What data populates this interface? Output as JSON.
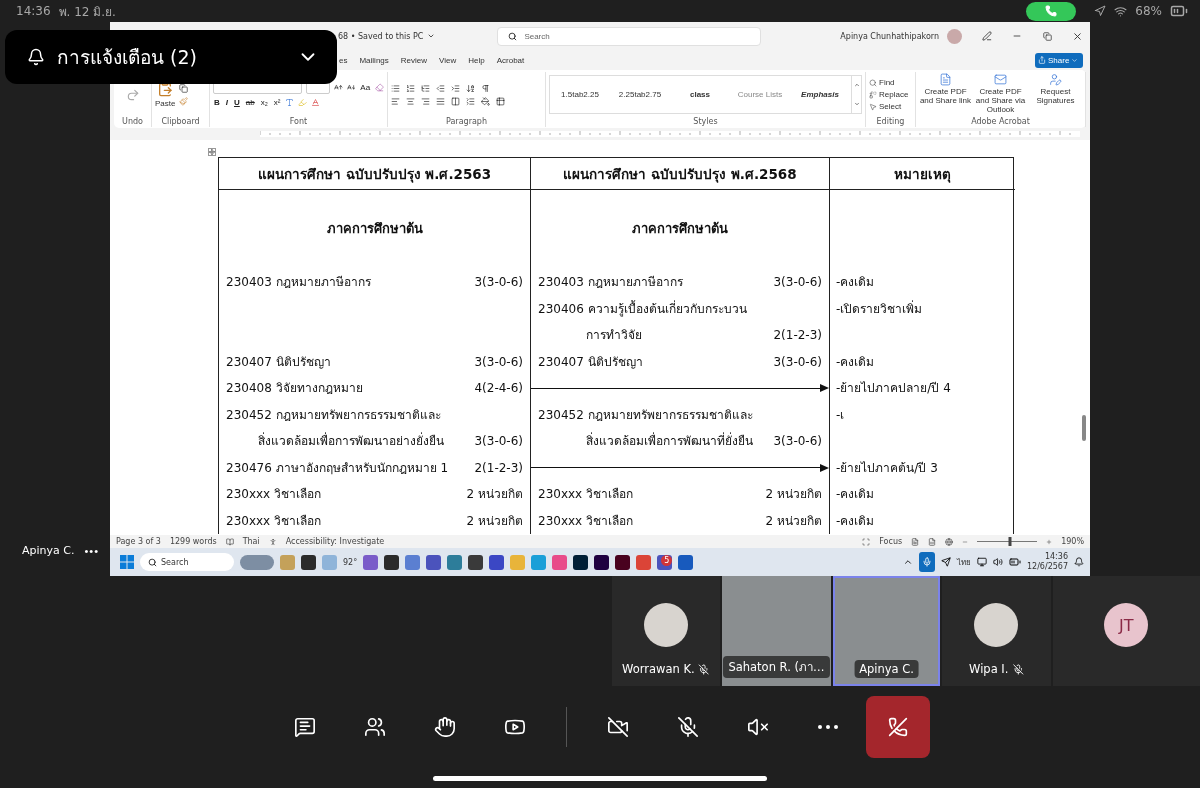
{
  "status_bar": {
    "time": "14:36",
    "date": "พ. 12 มิ.ย.",
    "battery": "68%"
  },
  "notification": {
    "title": "การแจ้งเตือน (2)"
  },
  "word": {
    "title": "68 • Saved to this PC",
    "search": {
      "placeholder": "Search"
    },
    "user": "Apinya Chunhathipakorn",
    "share": "Share",
    "tabs": [
      "es",
      "Mailings",
      "Review",
      "View",
      "Help",
      "Acrobat"
    ],
    "ribbon": {
      "undo": "Undo",
      "paste": "Paste",
      "clipboard": "Clipboard",
      "font": {
        "label": "Font",
        "change_case": "Aa",
        "bold": "B",
        "italic": "I",
        "underline": "U",
        "strike": "ab",
        "subscript": "x₂",
        "superscript": "x²"
      },
      "paragraph": "Paragraph",
      "styles": {
        "label": "Styles",
        "items": [
          {
            "label": "1.5tab2.25",
            "kind": "plain"
          },
          {
            "label": "2.25tab2.75",
            "kind": "plain"
          },
          {
            "label": "class",
            "kind": "strong"
          },
          {
            "label": "Course Lists",
            "kind": "light"
          },
          {
            "label": "Emphasis",
            "kind": "emphasis"
          }
        ]
      },
      "editing": {
        "label": "Editing",
        "items": [
          {
            "label": "Find",
            "kind": "find"
          },
          {
            "label": "Replace",
            "kind": "replace"
          },
          {
            "label": "Select",
            "kind": "select"
          }
        ]
      },
      "acrobat": {
        "label": "Adobe Acrobat",
        "items": [
          {
            "label": "Create PDF and Share link",
            "kind": "pdf"
          },
          {
            "label": "Create PDF and Share via Outlook",
            "kind": "mail"
          },
          {
            "label": "Request Signatures",
            "kind": "sign"
          }
        ]
      }
    },
    "table": {
      "columns": [
        "แผนการศึกษา ฉบับปรับปรุง พ.ศ.2563",
        "แผนการศึกษา ฉบับปรับปรุง พ.ศ.2568",
        "หมายเหตุ"
      ],
      "semester": [
        "ภาคการศึกษาต้น",
        "ภาคการศึกษาต้น"
      ],
      "rows": [
        {
          "old": {
            "lines": [
              "230403 กฎหมายภาษีอากร"
            ],
            "credits": "3(3-0-6)"
          },
          "moved": false,
          "new": {
            "lines": [
              "230403 กฎหมายภาษีอากร"
            ],
            "credits": "3(3-0-6)"
          },
          "remark": "-คงเดิม"
        },
        {
          "moved": false,
          "new": {
            "lines": [
              "230406 ความรู้เบื้องต้นเกี่ยวกับกระบวน",
              "การทำวิจัย"
            ],
            "credits": "2(1-2-3)"
          },
          "remark": "-เปิดรายวิชาเพิ่ม"
        },
        {
          "old": {
            "lines": [
              "230407 นิติปรัชญา"
            ],
            "credits": "3(3-0-6)"
          },
          "moved": false,
          "new": {
            "lines": [
              "230407 นิติปรัชญา"
            ],
            "credits": "3(3-0-6)"
          },
          "remark": "-คงเดิม"
        },
        {
          "old": {
            "lines": [
              "230408 วิจัยทางกฎหมาย"
            ],
            "credits": "4(2-4-6)"
          },
          "moved": true,
          "remark": "-ย้ายไปภาคปลาย/ปี 4"
        },
        {
          "old": {
            "lines": [
              "230452 กฎหมายทรัพยากรธรรมชาติและ",
              "สิ่งแวดล้อมเพื่อการพัฒนาอย่างยั่งยืน"
            ],
            "credits": "3(3-0-6)"
          },
          "moved": false,
          "new": {
            "lines": [
              "230452 กฎหมายทรัพยากรธรรมชาติและ",
              "สิ่งแวดล้อมเพื่อการพัฒนาที่ยั่งยืน"
            ],
            "credits": "3(3-0-6)"
          },
          "remark": "-เ"
        },
        {
          "old": {
            "lines": [
              "230476 ภาษาอังกฤษสำหรับนักกฎหมาย 1"
            ],
            "credits": "2(1-2-3)"
          },
          "moved": true,
          "remark": "-ย้ายไปภาคต้น/ปี 3"
        },
        {
          "old": {
            "lines": [
              "230xxx  วิชาเลือก"
            ],
            "credits": "2 หน่วยกิต"
          },
          "moved": false,
          "new": {
            "lines": [
              "230xxx  วิชาเลือก"
            ],
            "credits": "2 หน่วยกิต"
          },
          "remark": "-คงเดิม"
        },
        {
          "old": {
            "lines": [
              "230xxx  วิชาเลือก"
            ],
            "credits": "2 หน่วยกิต"
          },
          "moved": false,
          "new": {
            "lines": [
              "230xxx  วิชาเลือก"
            ],
            "credits": "2 หน่วยกิต"
          },
          "remark": "-คงเดิม"
        }
      ]
    },
    "status": {
      "page": "Page 3 of 3",
      "words": "1299 words",
      "language": "Thai",
      "accessibility": "Accessibility: Investigate",
      "focus": "Focus",
      "zoom": "190%",
      "zoom_slider": {
        "level": 0.55
      }
    },
    "taskbar": {
      "search": "Search",
      "weather": "92°",
      "teams_badge": "5",
      "language": "ไทย",
      "time": "14:36",
      "date": "12/6/2567"
    }
  },
  "presenter": {
    "name": "Apinya C.",
    "more": "•••"
  },
  "participants": [
    {
      "name": "Worrawan K.",
      "kind": "avatar",
      "muted": true,
      "speaking": false
    },
    {
      "name": "Sahaton R. (ภา…",
      "kind": "video",
      "muted": false,
      "speaking": false
    },
    {
      "name": "Apinya C.",
      "kind": "video",
      "muted": false,
      "speaking": true
    },
    {
      "name": "Wipa I.",
      "kind": "avatar",
      "muted": true,
      "speaking": false
    },
    {
      "initials": "JT",
      "kind": "initials",
      "speaking": false
    }
  ],
  "call_controls": [
    {
      "kind": "chat"
    },
    {
      "kind": "people"
    },
    {
      "kind": "react"
    },
    {
      "kind": "share"
    },
    {
      "kind": "camera",
      "on": false
    },
    {
      "kind": "mic",
      "on": false
    },
    {
      "kind": "speaker",
      "on": false
    },
    {
      "kind": "more"
    },
    {
      "kind": "hangup"
    }
  ]
}
